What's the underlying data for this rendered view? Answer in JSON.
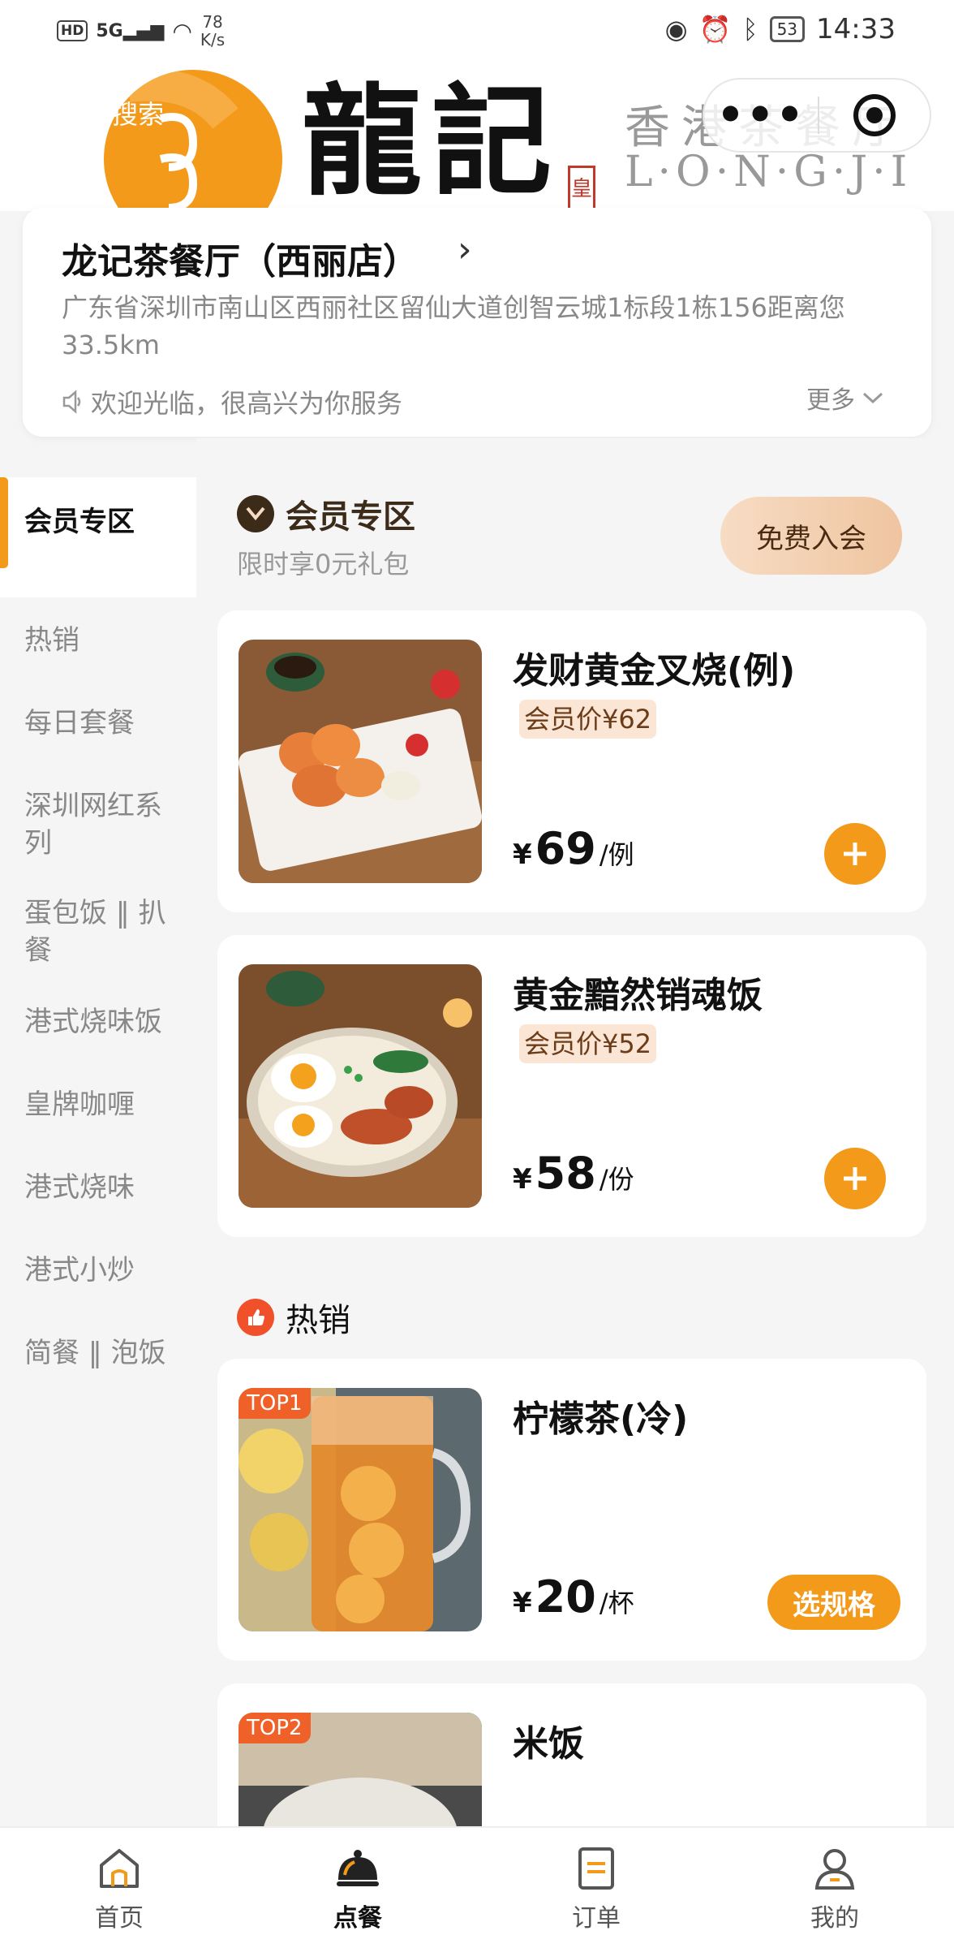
{
  "status_bar": {
    "hd": "HD",
    "network": "5G",
    "speed_value": "78",
    "speed_unit": "K/s",
    "battery": "53",
    "time": "14:33"
  },
  "header": {
    "search_label": "搜索",
    "brand_cn": "龍記",
    "brand_seal": "皇",
    "brand_tagline": "香港茶餐厅",
    "brand_en": "L·O·N·G·J·I",
    "capsule_more": "•••"
  },
  "store": {
    "name": "龙记茶餐厅（西丽店）",
    "address": "广东省深圳市南山区西丽社区留仙大道创智云城1标段1栋156距离您33.5km",
    "welcome": "欢迎光临，很高兴为你服务",
    "more": "更多"
  },
  "sidebar": {
    "items": [
      {
        "label": "会员专区"
      },
      {
        "label": "热销"
      },
      {
        "label": "每日套餐"
      },
      {
        "label": "深圳网红系列"
      },
      {
        "label": "蛋包饭 ‖ 扒餐"
      },
      {
        "label": "港式烧味饭"
      },
      {
        "label": "皇牌咖喱"
      },
      {
        "label": "港式烧味"
      },
      {
        "label": "港式小炒"
      },
      {
        "label": "简餐 ‖ 泡饭"
      }
    ]
  },
  "member_section": {
    "title": "会员专区",
    "subtitle": "限时享0元礼包",
    "join_label": "免费入会"
  },
  "hot_section": {
    "title": "热销"
  },
  "products": [
    {
      "name": "发财黄金叉烧(例)",
      "member_price": "会员价¥62",
      "yen": "¥",
      "price": "69",
      "unit": "/例"
    },
    {
      "name": "黄金黯然销魂饭",
      "member_price": "会员价¥52",
      "yen": "¥",
      "price": "58",
      "unit": "/份"
    },
    {
      "name": "柠檬茶(冷)",
      "badge": "TOP1",
      "yen": "¥",
      "price": "20",
      "unit": "/杯",
      "spec_label": "选规格"
    },
    {
      "name": "米饭",
      "badge": "TOP2"
    }
  ],
  "bottom_nav": [
    {
      "label": "首页"
    },
    {
      "label": "点餐"
    },
    {
      "label": "订单"
    },
    {
      "label": "我的"
    }
  ],
  "colors": {
    "accent": "#f39a1b",
    "badge": "#f0612a",
    "member_tag_bg": "#fbe5d4"
  }
}
